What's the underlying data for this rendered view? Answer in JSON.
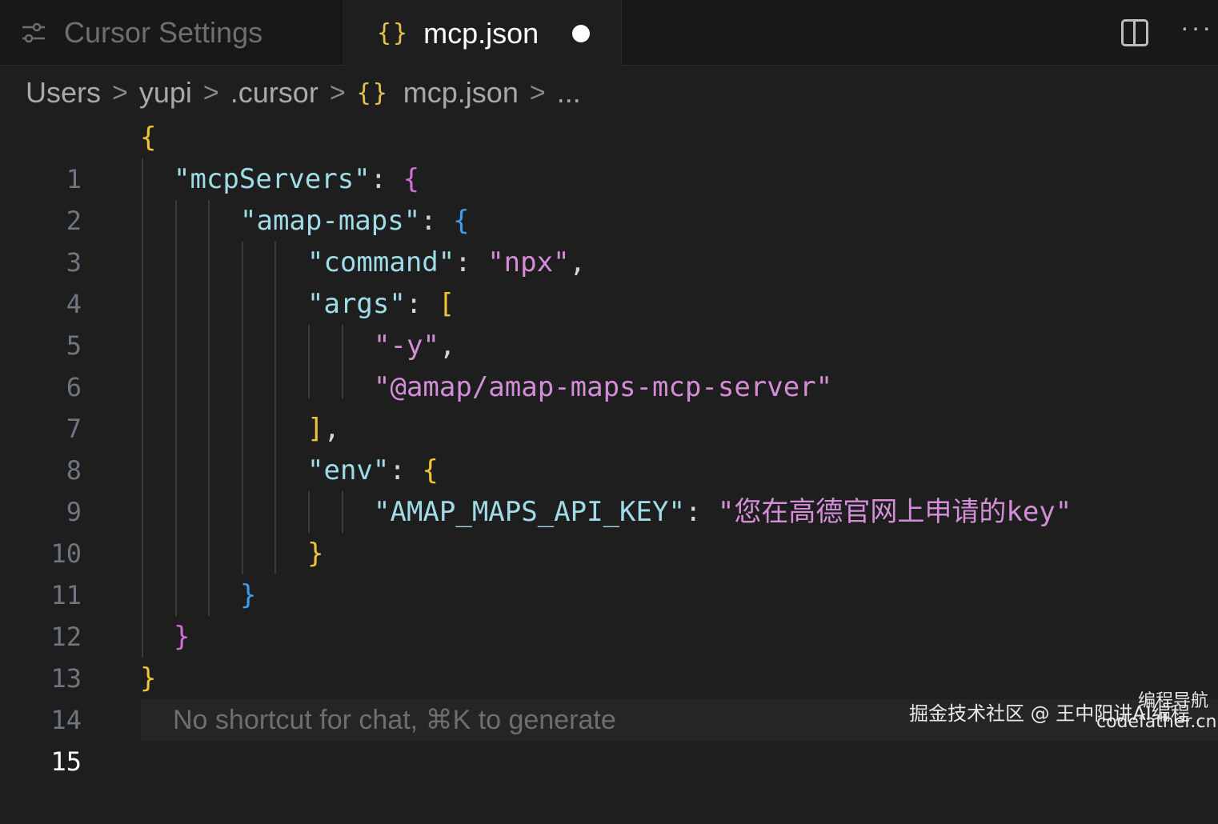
{
  "tabs": {
    "settings_label": "Cursor Settings",
    "file_icon": "{}",
    "file_label": "mcp.json"
  },
  "breadcrumb": {
    "items": [
      "Users",
      "yupi",
      ".cursor"
    ],
    "file_icon": "{}",
    "file": "mcp.json",
    "ellipsis": "...",
    "separator": ">"
  },
  "editor": {
    "line_numbers": [
      "1",
      "2",
      "3",
      "4",
      "5",
      "6",
      "7",
      "8",
      "9",
      "10",
      "11",
      "12",
      "13",
      "14",
      "15"
    ],
    "active_line": "15",
    "code": {
      "l1_open": "{",
      "l2_key": "\"mcpServers\"",
      "l2_colon": ": ",
      "l2_open": "{",
      "l3_key": "\"amap-maps\"",
      "l3_colon": ": ",
      "l3_open": "{",
      "l4_key": "\"command\"",
      "l4_colon": ": ",
      "l4_val": "\"npx\"",
      "l4_comma": ",",
      "l5_key": "\"args\"",
      "l5_colon": ": ",
      "l5_open": "[",
      "l6_val": "\"-y\"",
      "l6_comma": ",",
      "l7_val": "\"@amap/amap-maps-mcp-server\"",
      "l8_close": "]",
      "l8_comma": ",",
      "l9_key": "\"env\"",
      "l9_colon": ": ",
      "l9_open": "{",
      "l10_key": "\"AMAP_MAPS_API_KEY\"",
      "l10_colon": ": ",
      "l10_val": "\"您在高德官网上申请的key\"",
      "l11_close": "}",
      "l12_close": "}",
      "l13_close": "}",
      "l14_close": "}"
    },
    "hint": "No shortcut for chat, ⌘K to generate"
  },
  "watermark": {
    "main": "掘金技术社区 @ 王中阳讲AI编程",
    "nav": "编程导航",
    "site": "codefather.cn"
  },
  "icons": {
    "settings": "sliders-icon",
    "split": "split-editor-icon",
    "more": "more-actions-icon"
  },
  "colors": {
    "background": "#1e1e1e",
    "key": "#9fdce8",
    "string": "#d48ed8",
    "bracket_level1": "#f0c434",
    "bracket_level2": "#cf6fd4",
    "bracket_level3": "#3d9cf0"
  }
}
